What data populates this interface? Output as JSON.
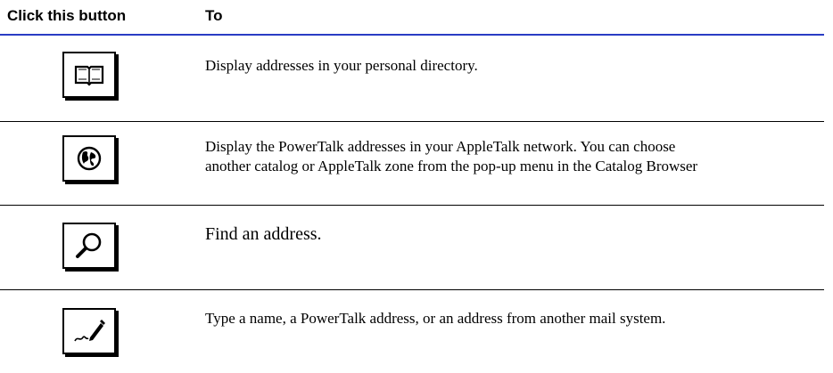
{
  "table": {
    "header": {
      "col1": "Click this button",
      "col2": "To"
    },
    "rows": [
      {
        "icon": "book-icon",
        "text": "Display addresses in your personal directory."
      },
      {
        "icon": "globe-icon",
        "text": "Display the PowerTalk addresses in your AppleTalk network. You can choose",
        "text2": "another catalog or AppleTalk zone from the pop-up menu in the Catalog Browser"
      },
      {
        "icon": "magnifier-icon",
        "text": "Find an address."
      },
      {
        "icon": "pen-icon",
        "text": "Type a name, a PowerTalk address, or an address from another mail system."
      }
    ]
  },
  "colors": {
    "header_rule": "#2a3cc4",
    "row_rule": "#000000"
  }
}
